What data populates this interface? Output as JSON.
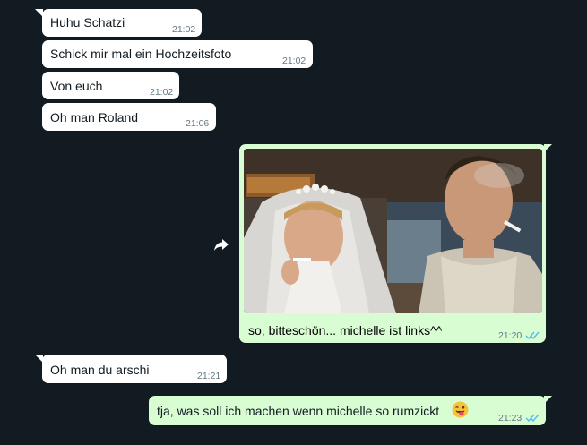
{
  "messages": [
    {
      "id": "m1",
      "direction": "incoming",
      "text": "Huhu Schatzi",
      "time": "21:02"
    },
    {
      "id": "m2",
      "direction": "incoming",
      "text": "Schick mir mal ein Hochzeitsfoto",
      "time": "21:02"
    },
    {
      "id": "m3",
      "direction": "incoming",
      "text": "Von euch",
      "time": "21:02"
    },
    {
      "id": "m4",
      "direction": "incoming",
      "text": "Oh man Roland",
      "time": "21:06"
    },
    {
      "id": "m5",
      "direction": "outgoing",
      "type": "image",
      "caption": "so, bitteschön... michelle ist links^^",
      "time": "21:20",
      "status": "read"
    },
    {
      "id": "m6",
      "direction": "incoming",
      "text": "Oh man du arschi",
      "time": "21:21"
    },
    {
      "id": "m7",
      "direction": "outgoing",
      "text": "tja, was soll ich machen wenn michelle so rumzickt",
      "time": "21:23",
      "status": "read",
      "emoji": "winking-face-with-tongue"
    }
  ],
  "colors": {
    "background": "#121b22",
    "incoming_bubble": "#ffffff",
    "outgoing_bubble": "#d9fdd3",
    "read_ticks": "#53bdeb",
    "timestamp": "#667781"
  },
  "icons": {
    "forward": "forward-icon",
    "read_receipt": "double-check-icon"
  }
}
